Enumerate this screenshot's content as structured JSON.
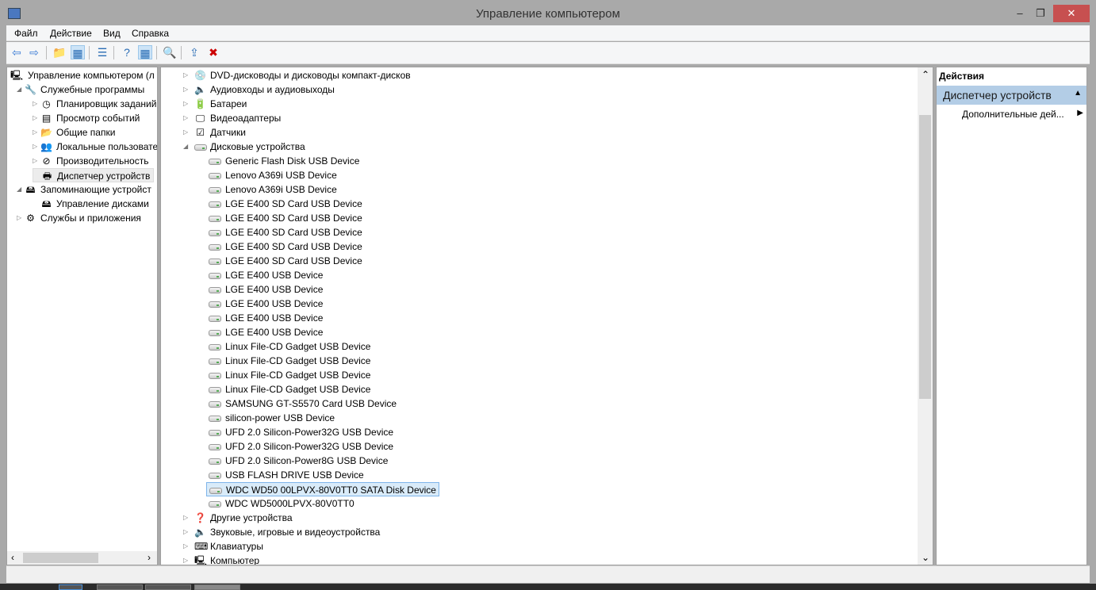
{
  "window": {
    "title": "Управление компьютером",
    "minimize": "–",
    "restore": "❐",
    "close": "✕"
  },
  "menu": [
    "Файл",
    "Действие",
    "Вид",
    "Справка"
  ],
  "toolbar": [
    {
      "icon": "back-icon",
      "g": "⇦"
    },
    {
      "icon": "forward-icon",
      "g": "⇨"
    },
    {
      "icon": "up-folder-icon",
      "g": "📁"
    },
    {
      "icon": "show-hide-tree-icon",
      "g": "▦",
      "on": true
    },
    {
      "icon": "properties-icon",
      "g": "☰"
    },
    {
      "icon": "help-icon",
      "g": "?"
    },
    {
      "icon": "show-hide-action-pane-icon",
      "g": "▦",
      "on": true
    },
    {
      "icon": "scan-hardware-icon",
      "g": "🔍"
    },
    {
      "icon": "update-driver-icon",
      "g": "⇪"
    },
    {
      "icon": "uninstall-icon",
      "g": "✖"
    }
  ],
  "left_tree": [
    {
      "label": "Управление компьютером (л",
      "level": 0,
      "exp": "",
      "icon": "computer-icon",
      "g": "🖳"
    },
    {
      "label": "Служебные программы",
      "level": 1,
      "exp": "◢",
      "icon": "tools-icon",
      "g": "🔧"
    },
    {
      "label": "Планировщик заданий",
      "level": 2,
      "exp": "▷",
      "icon": "clock-icon",
      "g": "◷"
    },
    {
      "label": "Просмотр событий",
      "level": 2,
      "exp": "▷",
      "icon": "event-viewer-icon",
      "g": "▤"
    },
    {
      "label": "Общие папки",
      "level": 2,
      "exp": "▷",
      "icon": "shared-folders-icon",
      "g": "📂"
    },
    {
      "label": "Локальные пользовате",
      "level": 2,
      "exp": "▷",
      "icon": "users-icon",
      "g": "👥"
    },
    {
      "label": "Производительность",
      "level": 2,
      "exp": "▷",
      "icon": "performance-icon",
      "g": "⊘"
    },
    {
      "label": "Диспетчер устройств",
      "level": 2,
      "exp": "",
      "icon": "device-manager-icon",
      "g": "🖶",
      "selected": true
    },
    {
      "label": "Запоминающие устройст",
      "level": 1,
      "exp": "◢",
      "icon": "storage-icon",
      "g": "🖴"
    },
    {
      "label": "Управление дисками",
      "level": 2,
      "exp": "",
      "icon": "disk-management-icon",
      "g": "🖴"
    },
    {
      "label": "Службы и приложения",
      "level": 1,
      "exp": "▷",
      "icon": "services-icon",
      "g": "⚙"
    }
  ],
  "devices": [
    {
      "label": "DVD-дисководы и дисководы компакт-дисков",
      "type": "cat",
      "exp": "▷",
      "icon": "dvd-icon",
      "g": "💿"
    },
    {
      "label": "Аудиовходы и аудиовыходы",
      "type": "cat",
      "exp": "▷",
      "icon": "speaker-icon",
      "g": "🔈"
    },
    {
      "label": "Батареи",
      "type": "cat",
      "exp": "▷",
      "icon": "battery-icon",
      "g": "🔋"
    },
    {
      "label": "Видеоадаптеры",
      "type": "cat",
      "exp": "▷",
      "icon": "display-adapter-icon",
      "g": "🖵"
    },
    {
      "label": "Датчики",
      "type": "cat",
      "exp": "▷",
      "icon": "sensor-icon",
      "g": "☑"
    },
    {
      "label": "Дисковые устройства",
      "type": "cat",
      "exp": "◢",
      "icon": "disk-drive-icon",
      "g": "disk"
    },
    {
      "label": "Generic Flash Disk USB Device",
      "type": "dev"
    },
    {
      "label": "Lenovo A369i USB Device",
      "type": "dev"
    },
    {
      "label": "Lenovo A369i USB Device",
      "type": "dev"
    },
    {
      "label": "LGE E400 SD Card USB Device",
      "type": "dev"
    },
    {
      "label": "LGE E400 SD Card USB Device",
      "type": "dev"
    },
    {
      "label": "LGE E400 SD Card USB Device",
      "type": "dev"
    },
    {
      "label": "LGE E400 SD Card USB Device",
      "type": "dev"
    },
    {
      "label": "LGE E400 SD Card USB Device",
      "type": "dev"
    },
    {
      "label": "LGE E400 USB Device",
      "type": "dev"
    },
    {
      "label": "LGE E400 USB Device",
      "type": "dev"
    },
    {
      "label": "LGE E400 USB Device",
      "type": "dev"
    },
    {
      "label": "LGE E400 USB Device",
      "type": "dev"
    },
    {
      "label": "LGE E400 USB Device",
      "type": "dev"
    },
    {
      "label": "Linux File-CD Gadget USB Device",
      "type": "dev"
    },
    {
      "label": "Linux File-CD Gadget USB Device",
      "type": "dev"
    },
    {
      "label": "Linux File-CD Gadget USB Device",
      "type": "dev"
    },
    {
      "label": "Linux File-CD Gadget USB Device",
      "type": "dev"
    },
    {
      "label": "SAMSUNG GT-S5570 Card USB Device",
      "type": "dev"
    },
    {
      "label": "silicon-power USB Device",
      "type": "dev"
    },
    {
      "label": "UFD 2.0 Silicon-Power32G USB Device",
      "type": "dev"
    },
    {
      "label": "UFD 2.0 Silicon-Power32G USB Device",
      "type": "dev"
    },
    {
      "label": "UFD 2.0 Silicon-Power8G USB Device",
      "type": "dev"
    },
    {
      "label": "USB FLASH DRIVE USB Device",
      "type": "dev"
    },
    {
      "label": "WDC WD50 00LPVX-80V0TT0 SATA Disk Device",
      "type": "dev",
      "selected": true
    },
    {
      "label": "WDC WD5000LPVX-80V0TT0",
      "type": "dev"
    },
    {
      "label": "Другие устройства",
      "type": "cat",
      "exp": "▷",
      "icon": "other-devices-icon",
      "g": "❓"
    },
    {
      "label": "Звуковые, игровые и видеоустройства",
      "type": "cat",
      "exp": "▷",
      "icon": "sound-icon",
      "g": "🔈"
    },
    {
      "label": "Клавиатуры",
      "type": "cat",
      "exp": "▷",
      "icon": "keyboard-icon",
      "g": "⌨"
    },
    {
      "label": "Компьютер",
      "type": "cat",
      "exp": "▷",
      "icon": "computer-icon",
      "g": "🖳"
    }
  ],
  "actions": {
    "header": "Действия",
    "section": "Диспетчер устройств",
    "more": "Дополнительные дей..."
  },
  "scroll": {
    "up": "⌃",
    "down": "⌄",
    "left": "‹",
    "right": "›"
  }
}
